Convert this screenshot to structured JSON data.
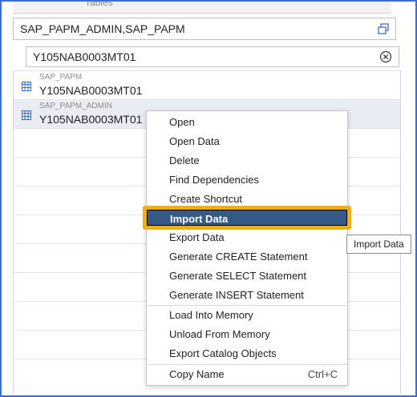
{
  "header": {
    "partial_top_text": "Tables"
  },
  "schema_bar": {
    "value": "SAP_PAPM_ADMIN,SAP_PAPM",
    "icon": "copy-icon"
  },
  "search": {
    "value": "Y105NAB0003MT01",
    "clear_icon": "clear-circle-icon"
  },
  "results": [
    {
      "schema": "SAP_PAPM",
      "name": "Y105NAB0003MT01",
      "icon": "table-icon",
      "selected": false
    },
    {
      "schema": "SAP_PAPM_ADMIN",
      "name": "Y105NAB0003MT01",
      "icon": "table-icon",
      "selected": true
    }
  ],
  "context_menu": {
    "groups": [
      [
        "Open",
        "Open Data",
        "Delete",
        "Find Dependencies",
        "Create Shortcut"
      ],
      [
        "Import Data",
        "Export Data",
        "Generate CREATE Statement",
        "Generate SELECT Statement",
        "Generate INSERT Statement"
      ],
      [
        "Load Into Memory",
        "Unload From Memory",
        "Export Catalog Objects"
      ],
      [
        "Copy Name"
      ]
    ],
    "highlighted": "Import Data",
    "copy_name_shortcut": "Ctrl+C"
  },
  "tooltip": {
    "text": "Import Data"
  },
  "colors": {
    "frame_border": "#3f6bd6",
    "highlight_outline": "#f2ad1b",
    "highlight_fill": "#355a86",
    "selected_row": "#e9edf3"
  }
}
